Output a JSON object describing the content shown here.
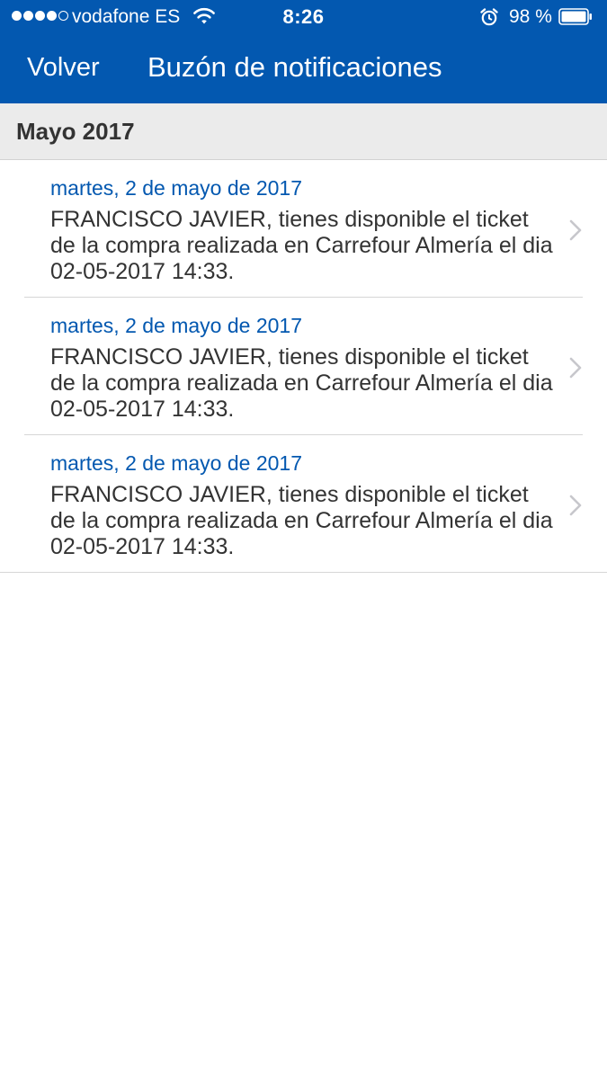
{
  "status_bar": {
    "carrier": "vodafone ES",
    "time": "8:26",
    "battery_percent": "98 %",
    "signal_bars_filled": 4,
    "signal_bars_total": 5
  },
  "nav": {
    "back_label": "Volver",
    "title": "Buzón de notificaciones"
  },
  "section": {
    "title": "Mayo 2017"
  },
  "notifications": [
    {
      "date": "martes, 2 de mayo de 2017",
      "message": "FRANCISCO JAVIER, tienes disponible el ticket de la compra realizada en Carrefour Almería el dia 02-05-2017 14:33."
    },
    {
      "date": "martes, 2 de mayo de 2017",
      "message": "FRANCISCO JAVIER, tienes disponible el ticket de la compra realizada en Carrefour Almería el dia 02-05-2017 14:33."
    },
    {
      "date": "martes, 2 de mayo de 2017",
      "message": "FRANCISCO JAVIER, tienes disponible el ticket de la compra realizada en Carrefour Almería el dia 02-05-2017 14:33."
    }
  ],
  "colors": {
    "brand_blue": "#0358b0",
    "section_bg": "#ebebeb",
    "text_dark": "#333333",
    "chevron": "#c7c7cc"
  },
  "icons": {
    "wifi": "wifi-icon",
    "alarm": "alarm-clock-icon",
    "battery": "battery-icon",
    "chevron": "chevron-right-icon"
  }
}
